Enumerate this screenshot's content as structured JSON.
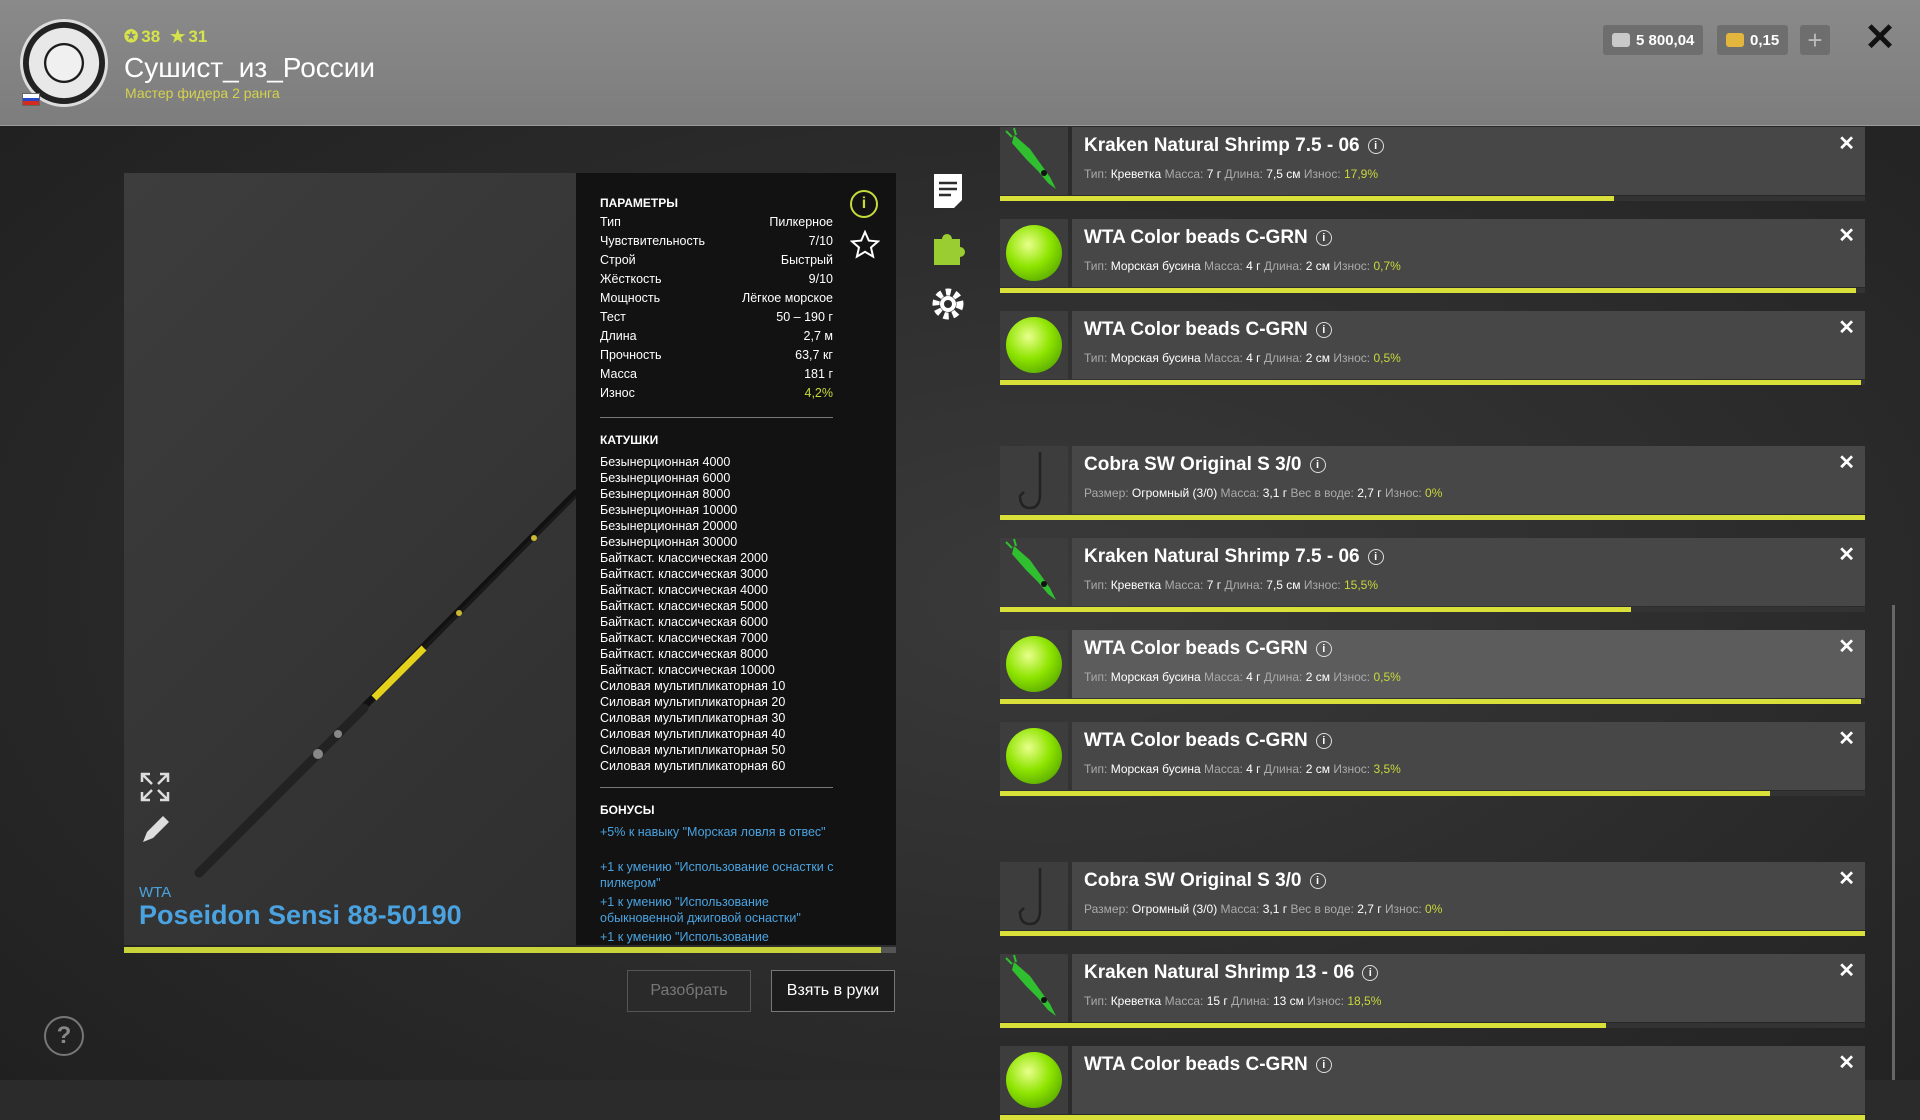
{
  "header": {
    "level": "38",
    "stars": "31",
    "username": "Сушист_из_России",
    "rank": "Мастер фидера 2 ранга",
    "silver": "5 800,04",
    "gold": "0,15"
  },
  "rod": {
    "brand": "WTA",
    "name": "Poseidon Sensi 88-50190",
    "progress": 0.98
  },
  "params": {
    "title": "ПАРАМЕТРЫ",
    "rows": [
      {
        "label": "Тип",
        "value": "Пилкерное"
      },
      {
        "label": "Чувствительность",
        "value": "7/10"
      },
      {
        "label": "Строй",
        "value": "Быстрый"
      },
      {
        "label": "Жёсткость",
        "value": "9/10"
      },
      {
        "label": "Мощность",
        "value": "Лёгкое морское"
      },
      {
        "label": "Тест",
        "value": "50 – 190 г"
      },
      {
        "label": "Длина",
        "value": "2,7 м"
      },
      {
        "label": "Прочность",
        "value": "63,7 кг"
      },
      {
        "label": "Масса",
        "value": "181 г"
      },
      {
        "label": "Износ",
        "value": "4,2%"
      }
    ],
    "reels_title": "КАТУШКИ",
    "reels": [
      "Безынерционная 4000",
      "Безынерционная 6000",
      "Безынерционная 8000",
      "Безынерционная 10000",
      "Безынерционная 20000",
      "Безынерционная 30000",
      "Байткаст. классическая 2000",
      "Байткаст. классическая 3000",
      "Байткаст. классическая 4000",
      "Байткаст. классическая 5000",
      "Байткаст. классическая 6000",
      "Байткаст. классическая 7000",
      "Байткаст. классическая 8000",
      "Байткаст. классическая 10000",
      "Силовая мультипликаторная 10",
      "Силовая мультипликаторная 20",
      "Силовая мультипликаторная 30",
      "Силовая мультипликаторная 40",
      "Силовая мультипликаторная 50",
      "Силовая мультипликаторная 60"
    ],
    "bonus_title": "БОНУСЫ",
    "bonuses": [
      "+5% к навыку \"Морская ловля в отвес\"",
      "+1 к умению \"Использование оснастки с пилкером\"",
      "+1 к умению \"Использование обыкновенной джиговой оснастки\"",
      "+1 к умению \"Использование"
    ]
  },
  "buttons": {
    "disassemble": "Разобрать",
    "take": "Взять в руки"
  },
  "items": [
    {
      "type": "shrimp",
      "name": "Kraken Natural Shrimp 7.5 - 06",
      "props": [
        [
          "Тип:",
          "Креветка"
        ],
        [
          "Масса:",
          "7 г"
        ],
        [
          "Длина:",
          "7,5 см"
        ]
      ],
      "wear_label": "Износ:",
      "wear": "17,9%",
      "condition": 0.71
    },
    {
      "type": "bead",
      "name": "WTA Color beads C-GRN",
      "props": [
        [
          "Тип:",
          "Морская бусина"
        ],
        [
          "Масса:",
          "4 г"
        ],
        [
          "Длина:",
          "2 см"
        ]
      ],
      "wear_label": "Износ:",
      "wear": "0,7%",
      "condition": 0.99
    },
    {
      "type": "bead",
      "name": "WTA Color beads C-GRN",
      "props": [
        [
          "Тип:",
          "Морская бусина"
        ],
        [
          "Масса:",
          "4 г"
        ],
        [
          "Длина:",
          "2 см"
        ]
      ],
      "wear_label": "Износ:",
      "wear": "0,5%",
      "condition": 0.995
    },
    {
      "type": "hook",
      "name": "Cobra SW Original S 3/0",
      "props": [
        [
          "Размер:",
          "Огромный (3/0)"
        ],
        [
          "Масса:",
          "3,1 г"
        ],
        [
          "Вес в воде:",
          "2,7 г"
        ]
      ],
      "wear_label": "Износ:",
      "wear": "0%",
      "condition": 1.0
    },
    {
      "type": "shrimp",
      "name": "Kraken Natural Shrimp 7.5 - 06",
      "props": [
        [
          "Тип:",
          "Креветка"
        ],
        [
          "Масса:",
          "7 г"
        ],
        [
          "Длина:",
          "7,5 см"
        ]
      ],
      "wear_label": "Износ:",
      "wear": "15,5%",
      "condition": 0.73
    },
    {
      "type": "bead",
      "name": "WTA Color beads C-GRN",
      "props": [
        [
          "Тип:",
          "Морская бусина"
        ],
        [
          "Масса:",
          "4 г"
        ],
        [
          "Длина:",
          "2 см"
        ]
      ],
      "wear_label": "Износ:",
      "wear": "0,5%",
      "condition": 0.995
    },
    {
      "type": "bead",
      "name": "WTA Color beads C-GRN",
      "props": [
        [
          "Тип:",
          "Морская бусина"
        ],
        [
          "Масса:",
          "4 г"
        ],
        [
          "Длина:",
          "2 см"
        ]
      ],
      "wear_label": "Износ:",
      "wear": "3,5%",
      "condition": 0.89
    },
    {
      "type": "hook",
      "name": "Cobra SW Original S 3/0",
      "props": [
        [
          "Размер:",
          "Огромный (3/0)"
        ],
        [
          "Масса:",
          "3,1 г"
        ],
        [
          "Вес в воде:",
          "2,7 г"
        ]
      ],
      "wear_label": "Износ:",
      "wear": "0%",
      "condition": 1.0
    },
    {
      "type": "shrimp",
      "name": "Kraken Natural Shrimp 13 - 06",
      "props": [
        [
          "Тип:",
          "Креветка"
        ],
        [
          "Масса:",
          "15 г"
        ],
        [
          "Длина:",
          "13 см"
        ]
      ],
      "wear_label": "Износ:",
      "wear": "18,5%",
      "condition": 0.7
    },
    {
      "type": "bead",
      "name": "WTA Color beads C-GRN",
      "props": [],
      "wear_label": "",
      "wear": "",
      "condition": 1.0
    }
  ],
  "colors": {
    "accent": "#c8d93a",
    "link": "#4aa3e0"
  },
  "icons": [
    "coin-silver-icon",
    "coin-gold-icon",
    "plus-icon",
    "close-icon",
    "info-icon",
    "star-icon",
    "document-icon",
    "puzzle-icon",
    "gear-icon",
    "fullscreen-icon",
    "pencil-icon",
    "help-icon"
  ]
}
